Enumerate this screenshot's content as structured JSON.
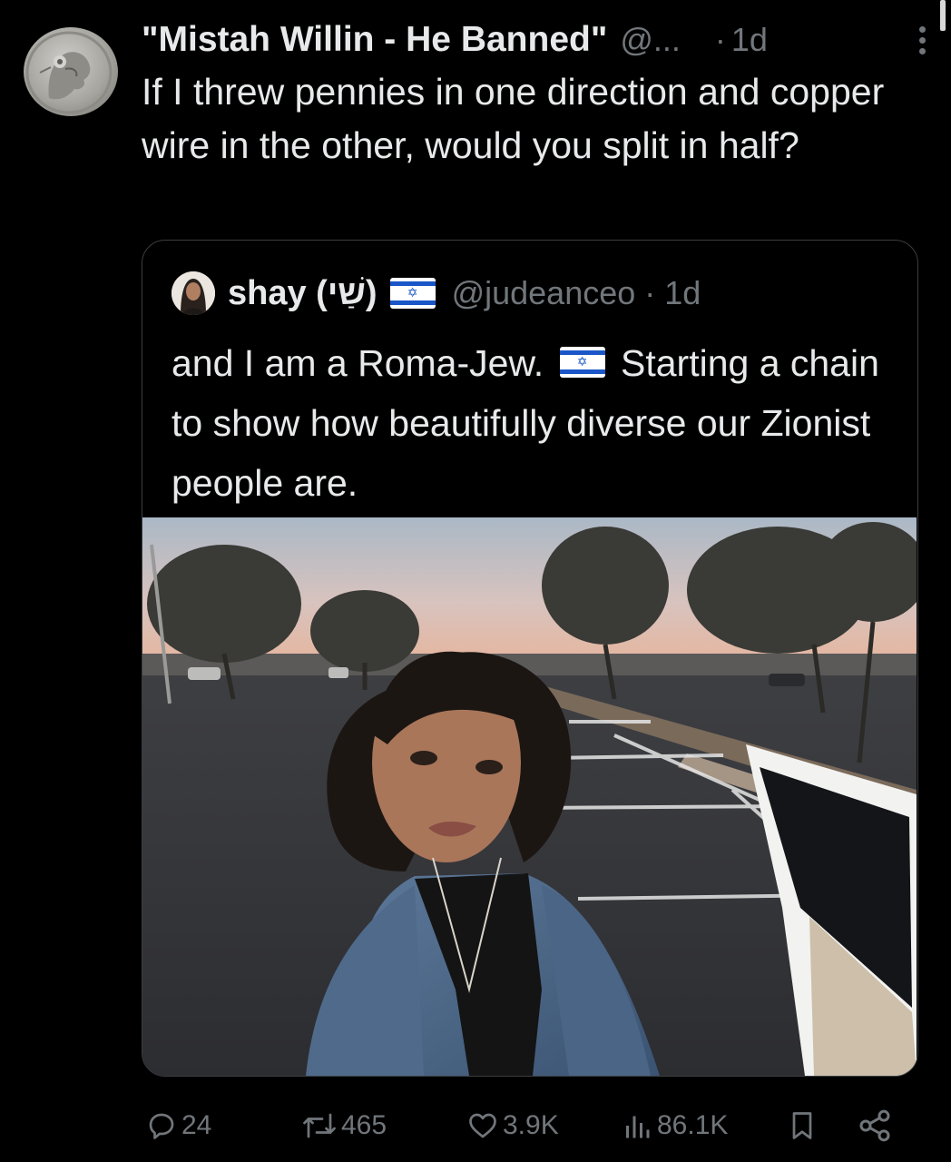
{
  "tweet": {
    "display_name": "\"Mistah Willin - He Banned\"",
    "handle": "@...",
    "dot": "·",
    "time": "1d",
    "text": "If I threw pennies in one direction and copper wire in the other, would you split in half?"
  },
  "quoted_tweet": {
    "display_name": "shay (שַׁי)",
    "handle": "@judeanceo · 1d",
    "text_before_flag": "and I am a Roma-Jew.",
    "text_after_flag": "Starting a chain to show how beautifully diverse our Zionist people are."
  },
  "actions": {
    "replies": "24",
    "reposts": "465",
    "likes": "3.9K",
    "views": "86.1K"
  },
  "icons": {
    "more": "more-options-icon",
    "reply": "reply-icon",
    "repost": "repost-icon",
    "like": "heart-icon",
    "views": "views-icon",
    "bookmark": "bookmark-icon",
    "share": "share-icon",
    "flag": "israel-flag-icon"
  },
  "colors": {
    "background": "#000000",
    "text": "#e7e9ea",
    "muted": "#71767b",
    "border": "#3a3d40"
  }
}
